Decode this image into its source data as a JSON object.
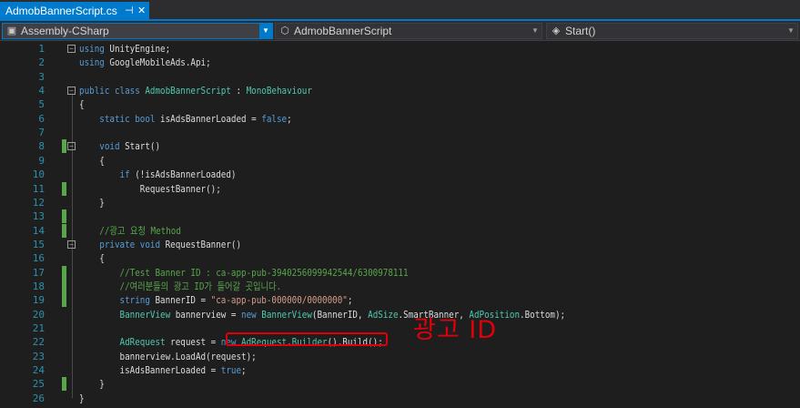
{
  "tab": {
    "label": "AdmobBannerScript.cs",
    "pin_glyph": "⊣",
    "close_glyph": "✕"
  },
  "navbar": {
    "project": {
      "label": "Assembly-CSharp",
      "icon": "project-icon"
    },
    "type": {
      "label": "AdmobBannerScript",
      "icon": "class-icon"
    },
    "member": {
      "label": "Start()",
      "icon": "method-icon"
    }
  },
  "annotation": {
    "text": "광고 ID",
    "color": "#e0000a"
  },
  "colors": {
    "keyword": "#569cd6",
    "type": "#4ec9b0",
    "string": "#d69d85",
    "comment": "#57a64a",
    "line_number": "#2b91af",
    "accent": "#007acc"
  },
  "lines": [
    {
      "n": "1",
      "fold": true,
      "change": false,
      "segs": [
        [
          "kw",
          "using"
        ],
        [
          "t",
          " UnityEngine;"
        ]
      ]
    },
    {
      "n": "2",
      "fold": false,
      "change": false,
      "segs": [
        [
          "kw",
          "using"
        ],
        [
          "t",
          " GoogleMobileAds.Api;"
        ]
      ]
    },
    {
      "n": "3",
      "fold": false,
      "change": false,
      "segs": []
    },
    {
      "n": "4",
      "fold": true,
      "change": false,
      "segs": [
        [
          "kw",
          "public"
        ],
        [
          "t",
          " "
        ],
        [
          "kw",
          "class"
        ],
        [
          "t",
          " "
        ],
        [
          "ty",
          "AdmobBannerScript"
        ],
        [
          "t",
          " : "
        ],
        [
          "ty",
          "MonoBehaviour"
        ]
      ]
    },
    {
      "n": "5",
      "fold": false,
      "change": false,
      "segs": [
        [
          "t",
          "{"
        ]
      ]
    },
    {
      "n": "6",
      "fold": false,
      "change": false,
      "segs": [
        [
          "t",
          "    "
        ],
        [
          "kw",
          "static"
        ],
        [
          "t",
          " "
        ],
        [
          "kw",
          "bool"
        ],
        [
          "t",
          " isAdsBannerLoaded = "
        ],
        [
          "kw",
          "false"
        ],
        [
          "t",
          ";"
        ]
      ]
    },
    {
      "n": "7",
      "fold": false,
      "change": false,
      "segs": []
    },
    {
      "n": "8",
      "fold": true,
      "change": true,
      "segs": [
        [
          "t",
          "    "
        ],
        [
          "kw",
          "void"
        ],
        [
          "t",
          " Start()"
        ]
      ]
    },
    {
      "n": "9",
      "fold": false,
      "change": false,
      "segs": [
        [
          "t",
          "    {"
        ]
      ]
    },
    {
      "n": "10",
      "fold": false,
      "change": false,
      "segs": [
        [
          "t",
          "        "
        ],
        [
          "kw",
          "if"
        ],
        [
          "t",
          " (!isAdsBannerLoaded)"
        ]
      ]
    },
    {
      "n": "11",
      "fold": false,
      "change": true,
      "segs": [
        [
          "t",
          "            RequestBanner();"
        ]
      ]
    },
    {
      "n": "12",
      "fold": false,
      "change": false,
      "segs": [
        [
          "t",
          "    }"
        ]
      ]
    },
    {
      "n": "13",
      "fold": false,
      "change": true,
      "segs": []
    },
    {
      "n": "14",
      "fold": false,
      "change": true,
      "segs": [
        [
          "t",
          "    "
        ],
        [
          "cm",
          "//광고 요청 Method"
        ]
      ]
    },
    {
      "n": "15",
      "fold": true,
      "change": false,
      "segs": [
        [
          "t",
          "    "
        ],
        [
          "kw",
          "private"
        ],
        [
          "t",
          " "
        ],
        [
          "kw",
          "void"
        ],
        [
          "t",
          " RequestBanner()"
        ]
      ]
    },
    {
      "n": "16",
      "fold": false,
      "change": false,
      "segs": [
        [
          "t",
          "    {"
        ]
      ]
    },
    {
      "n": "17",
      "fold": false,
      "change": true,
      "segs": [
        [
          "t",
          "        "
        ],
        [
          "cm",
          "//Test Banner ID : ca-app-pub-3940256099942544/6300978111"
        ]
      ]
    },
    {
      "n": "18",
      "fold": false,
      "change": true,
      "segs": [
        [
          "t",
          "        "
        ],
        [
          "cm",
          "//여러분들의 광고 ID가 들어갈 곳입니다."
        ]
      ]
    },
    {
      "n": "19",
      "fold": false,
      "change": true,
      "segs": [
        [
          "t",
          "        "
        ],
        [
          "kw",
          "string"
        ],
        [
          "t",
          " BannerID = "
        ],
        [
          "st",
          "\"ca-app-pub-000000/0000000\""
        ],
        [
          "t",
          ";"
        ]
      ]
    },
    {
      "n": "20",
      "fold": false,
      "change": false,
      "segs": [
        [
          "t",
          "        "
        ],
        [
          "ty",
          "BannerView"
        ],
        [
          "t",
          " bannerview = "
        ],
        [
          "kw",
          "new"
        ],
        [
          "t",
          " "
        ],
        [
          "ty",
          "BannerView"
        ],
        [
          "t",
          "(BannerID, "
        ],
        [
          "ty",
          "AdSize"
        ],
        [
          "t",
          ".SmartBanner, "
        ],
        [
          "ty",
          "AdPosition"
        ],
        [
          "t",
          ".Bottom);"
        ]
      ]
    },
    {
      "n": "21",
      "fold": false,
      "change": false,
      "segs": []
    },
    {
      "n": "22",
      "fold": false,
      "change": false,
      "segs": [
        [
          "t",
          "        "
        ],
        [
          "ty",
          "AdRequest"
        ],
        [
          "t",
          " request = "
        ],
        [
          "kw",
          "new"
        ],
        [
          "t",
          " "
        ],
        [
          "ty",
          "AdRequest"
        ],
        [
          "t",
          "."
        ],
        [
          "ty",
          "Builder"
        ],
        [
          "t",
          "().Build();"
        ]
      ]
    },
    {
      "n": "23",
      "fold": false,
      "change": false,
      "segs": [
        [
          "t",
          "        bannerview.LoadAd(request);"
        ]
      ]
    },
    {
      "n": "24",
      "fold": false,
      "change": false,
      "segs": [
        [
          "t",
          "        isAdsBannerLoaded = "
        ],
        [
          "kw",
          "true"
        ],
        [
          "t",
          ";"
        ]
      ]
    },
    {
      "n": "25",
      "fold": false,
      "change": true,
      "segs": [
        [
          "t",
          "    }"
        ]
      ]
    },
    {
      "n": "26",
      "fold": false,
      "change": false,
      "segs": [
        [
          "t",
          "}"
        ]
      ]
    }
  ]
}
